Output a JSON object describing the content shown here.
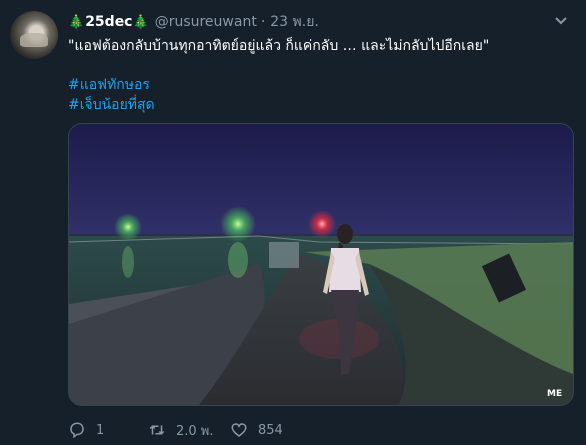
{
  "tweet": {
    "tree_left": "🎄",
    "display_name": "25dec",
    "tree_right": "🎄",
    "handle": "@rusureuwant",
    "separator": "·",
    "time": "23 พ.ย.",
    "text": "\"แอฟต้องกลับบ้านทุกอาทิตย์อยู่แล้ว ก็แค่กลับ … และไม่กลับไปอีกเลย\"",
    "hashtags": [
      "#แอฟทักษอร",
      "#เจ็บน้อยที่สุด"
    ],
    "media_watermark": "ME",
    "actions": {
      "replies": "1",
      "retweets": "2.0 พ.",
      "likes": "854"
    }
  },
  "colors": {
    "background": "#15202b",
    "secondary_text": "#8899a6",
    "link": "#1da1f2"
  },
  "icons": [
    "chevron-down-icon",
    "reply-icon",
    "retweet-icon",
    "like-icon"
  ]
}
